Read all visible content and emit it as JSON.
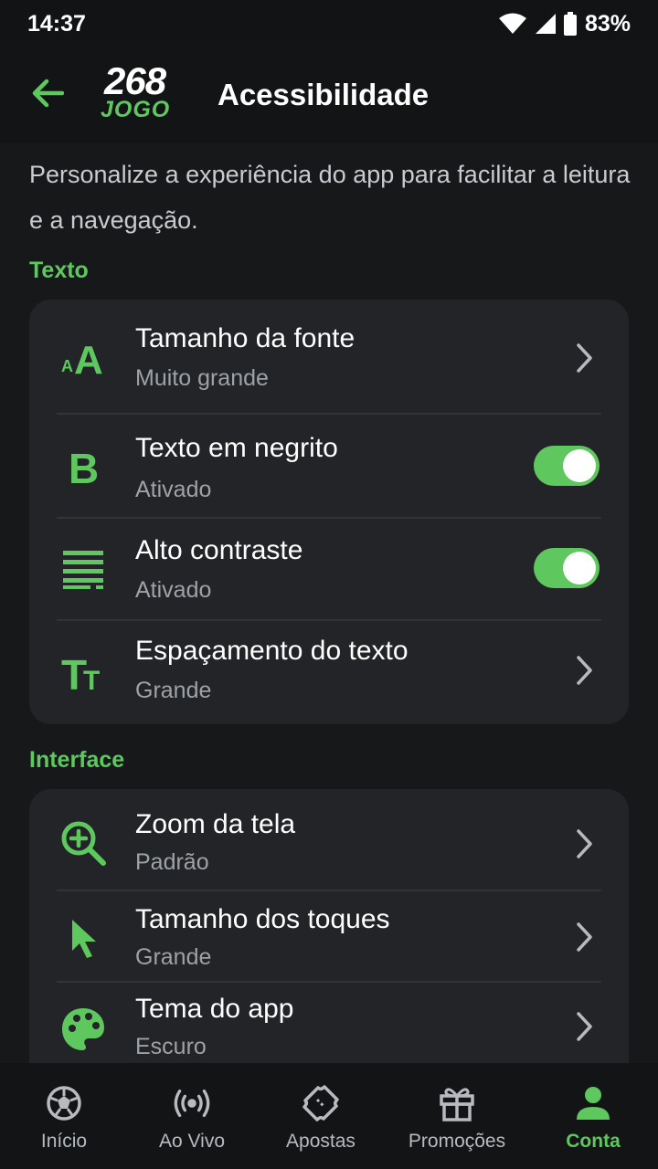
{
  "status_bar": {
    "time": "14:37",
    "battery": "83%"
  },
  "app_bar": {
    "logo_top": "268",
    "logo_bottom": "JOGO",
    "title": "Acessibilidade"
  },
  "intro": "Personalize a experiência do app para facilitar a leitura e a navegação.",
  "sections": {
    "texto": {
      "label": "Texto",
      "items": [
        {
          "title": "Tamanho da fonte",
          "subtitle": "Muito grande",
          "icon": "font-size-icon",
          "control": "chevron"
        },
        {
          "title": "Texto em negrito",
          "subtitle": "Ativado",
          "icon": "bold-icon",
          "control": "toggle",
          "on": true
        },
        {
          "title": "Alto contraste",
          "subtitle": "Ativado",
          "icon": "contrast-icon",
          "control": "toggle",
          "on": true
        },
        {
          "title": "Espaçamento do texto",
          "subtitle": "Grande",
          "icon": "text-spacing-icon",
          "control": "chevron"
        }
      ]
    },
    "interface": {
      "label": "Interface",
      "items": [
        {
          "title": "Zoom da tela",
          "subtitle": "Padrão",
          "icon": "zoom-in-icon",
          "control": "chevron"
        },
        {
          "title": "Tamanho dos toques",
          "subtitle": "Grande",
          "icon": "pointer-icon",
          "control": "chevron"
        },
        {
          "title": "Tema do app",
          "subtitle": "Escuro",
          "icon": "palette-icon",
          "control": "chevron"
        }
      ]
    }
  },
  "bottom_nav": {
    "items": [
      {
        "label": "Início",
        "icon": "soccer-ball-icon"
      },
      {
        "label": "Ao Vivo",
        "icon": "live-broadcast-icon"
      },
      {
        "label": "Apostas",
        "icon": "ticket-icon"
      },
      {
        "label": "Promoções",
        "icon": "gift-icon"
      },
      {
        "label": "Conta",
        "icon": "person-icon",
        "active": true
      }
    ]
  },
  "colors": {
    "accent": "#5ec75e",
    "background": "#16181a",
    "card": "#222427",
    "muted_text": "#9ea2a7"
  }
}
